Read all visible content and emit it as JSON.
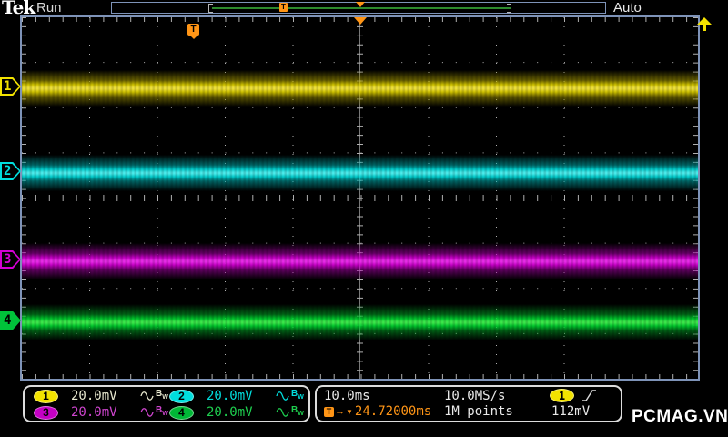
{
  "header": {
    "brand": "Tek",
    "acq_status": "Run",
    "trigger_mode": "Auto"
  },
  "channels": [
    {
      "number": "1",
      "scale": "20.0mV",
      "color": "#f2e200"
    },
    {
      "number": "2",
      "scale": "20.0mV",
      "color": "#00dede"
    },
    {
      "number": "3",
      "scale": "20.0mV",
      "color": "#d400d4"
    },
    {
      "number": "4",
      "scale": "20.0mV",
      "color": "#00c23a"
    }
  ],
  "horizontal": {
    "time_per_div": "10.0ms",
    "sample_rate": "10.0MS/s",
    "record_length": "1M points"
  },
  "trigger": {
    "source": "1",
    "slope": "rising",
    "level": "112mV",
    "position": "24.72000ms",
    "flag_label": "T",
    "arrow_glyph": "→",
    "triangle_glyph": "▼"
  },
  "icons": {
    "coupling": "ac-sine",
    "bandwidth_main": "B",
    "bandwidth_sub": "W"
  },
  "colors": {
    "accent_orange": "#ff9516",
    "graticule_border": "#7e93b8",
    "acq_window_green": "#2d8a2d"
  },
  "watermark": "PCMAG.VN"
}
